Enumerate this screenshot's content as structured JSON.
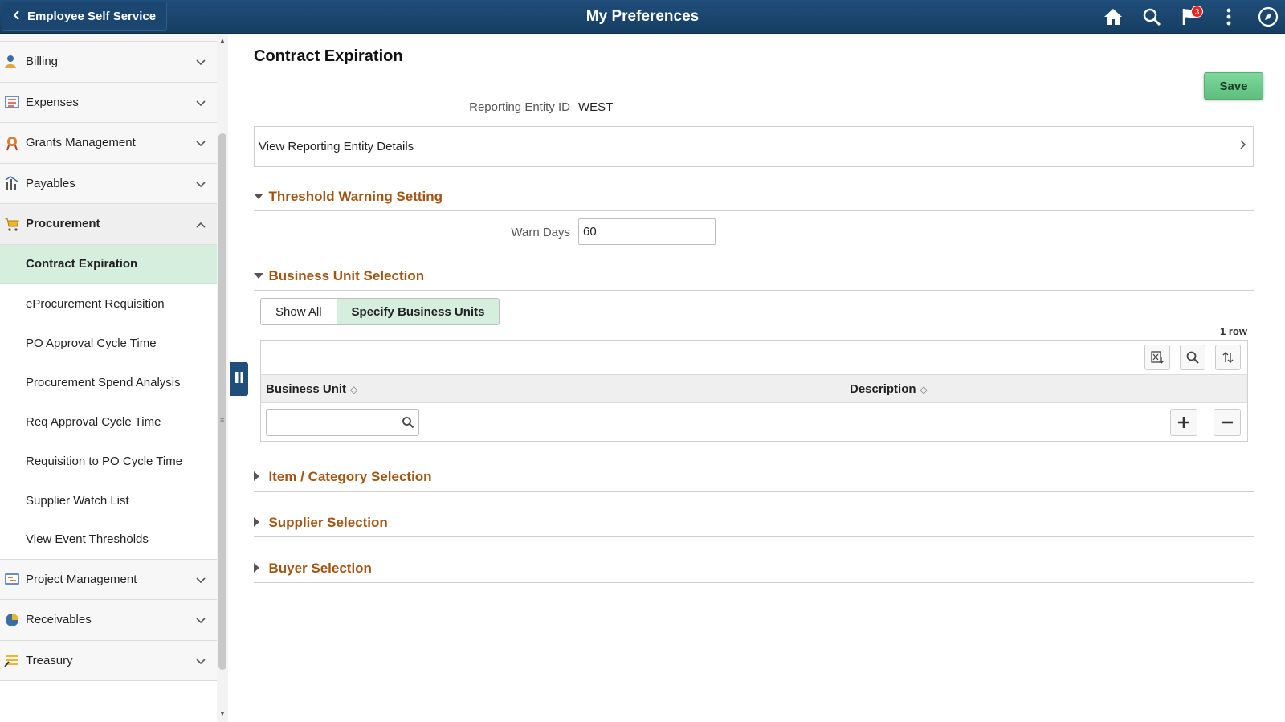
{
  "header": {
    "back_label": "Employee Self Service",
    "title": "My Preferences",
    "notification_count": "3"
  },
  "sidebar": {
    "items": [
      {
        "label": "Billing",
        "icon": "billing-icon"
      },
      {
        "label": "Expenses",
        "icon": "expenses-icon"
      },
      {
        "label": "Grants Management",
        "icon": "grants-icon"
      },
      {
        "label": "Payables",
        "icon": "payables-icon"
      },
      {
        "label": "Procurement",
        "icon": "procurement-icon",
        "expanded": true
      },
      {
        "label": "Project Management",
        "icon": "project-icon"
      },
      {
        "label": "Receivables",
        "icon": "receivables-icon"
      },
      {
        "label": "Treasury",
        "icon": "treasury-icon"
      }
    ],
    "procurement_children": [
      {
        "label": "Contract Expiration",
        "selected": true
      },
      {
        "label": "eProcurement Requisition"
      },
      {
        "label": "PO Approval Cycle Time"
      },
      {
        "label": "Procurement Spend Analysis"
      },
      {
        "label": "Req Approval Cycle Time"
      },
      {
        "label": "Requisition to PO Cycle Time"
      },
      {
        "label": "Supplier Watch List"
      },
      {
        "label": "View Event Thresholds"
      }
    ]
  },
  "main": {
    "title": "Contract Expiration",
    "save_label": "Save",
    "reporting_entity_label": "Reporting Entity ID",
    "reporting_entity_value": "WEST",
    "view_details_label": "View Reporting Entity Details",
    "threshold_section": "Threshold Warning Setting",
    "warn_days_label": "Warn Days",
    "warn_days_value": "60",
    "business_unit_section": "Business Unit Selection",
    "segments": [
      "Show All",
      "Specify Business Units"
    ],
    "active_segment": "Specify Business Units",
    "row_count": "1 row",
    "grid_columns": [
      "Business Unit",
      "Description"
    ],
    "item_category_section": "Item / Category Selection",
    "supplier_section": "Supplier Selection",
    "buyer_section": "Buyer Selection"
  },
  "colors": {
    "banner": "#1f4e7a",
    "section_title": "#a35412",
    "selected_bg": "#d5eedd",
    "save_button": "#6cc98c"
  }
}
